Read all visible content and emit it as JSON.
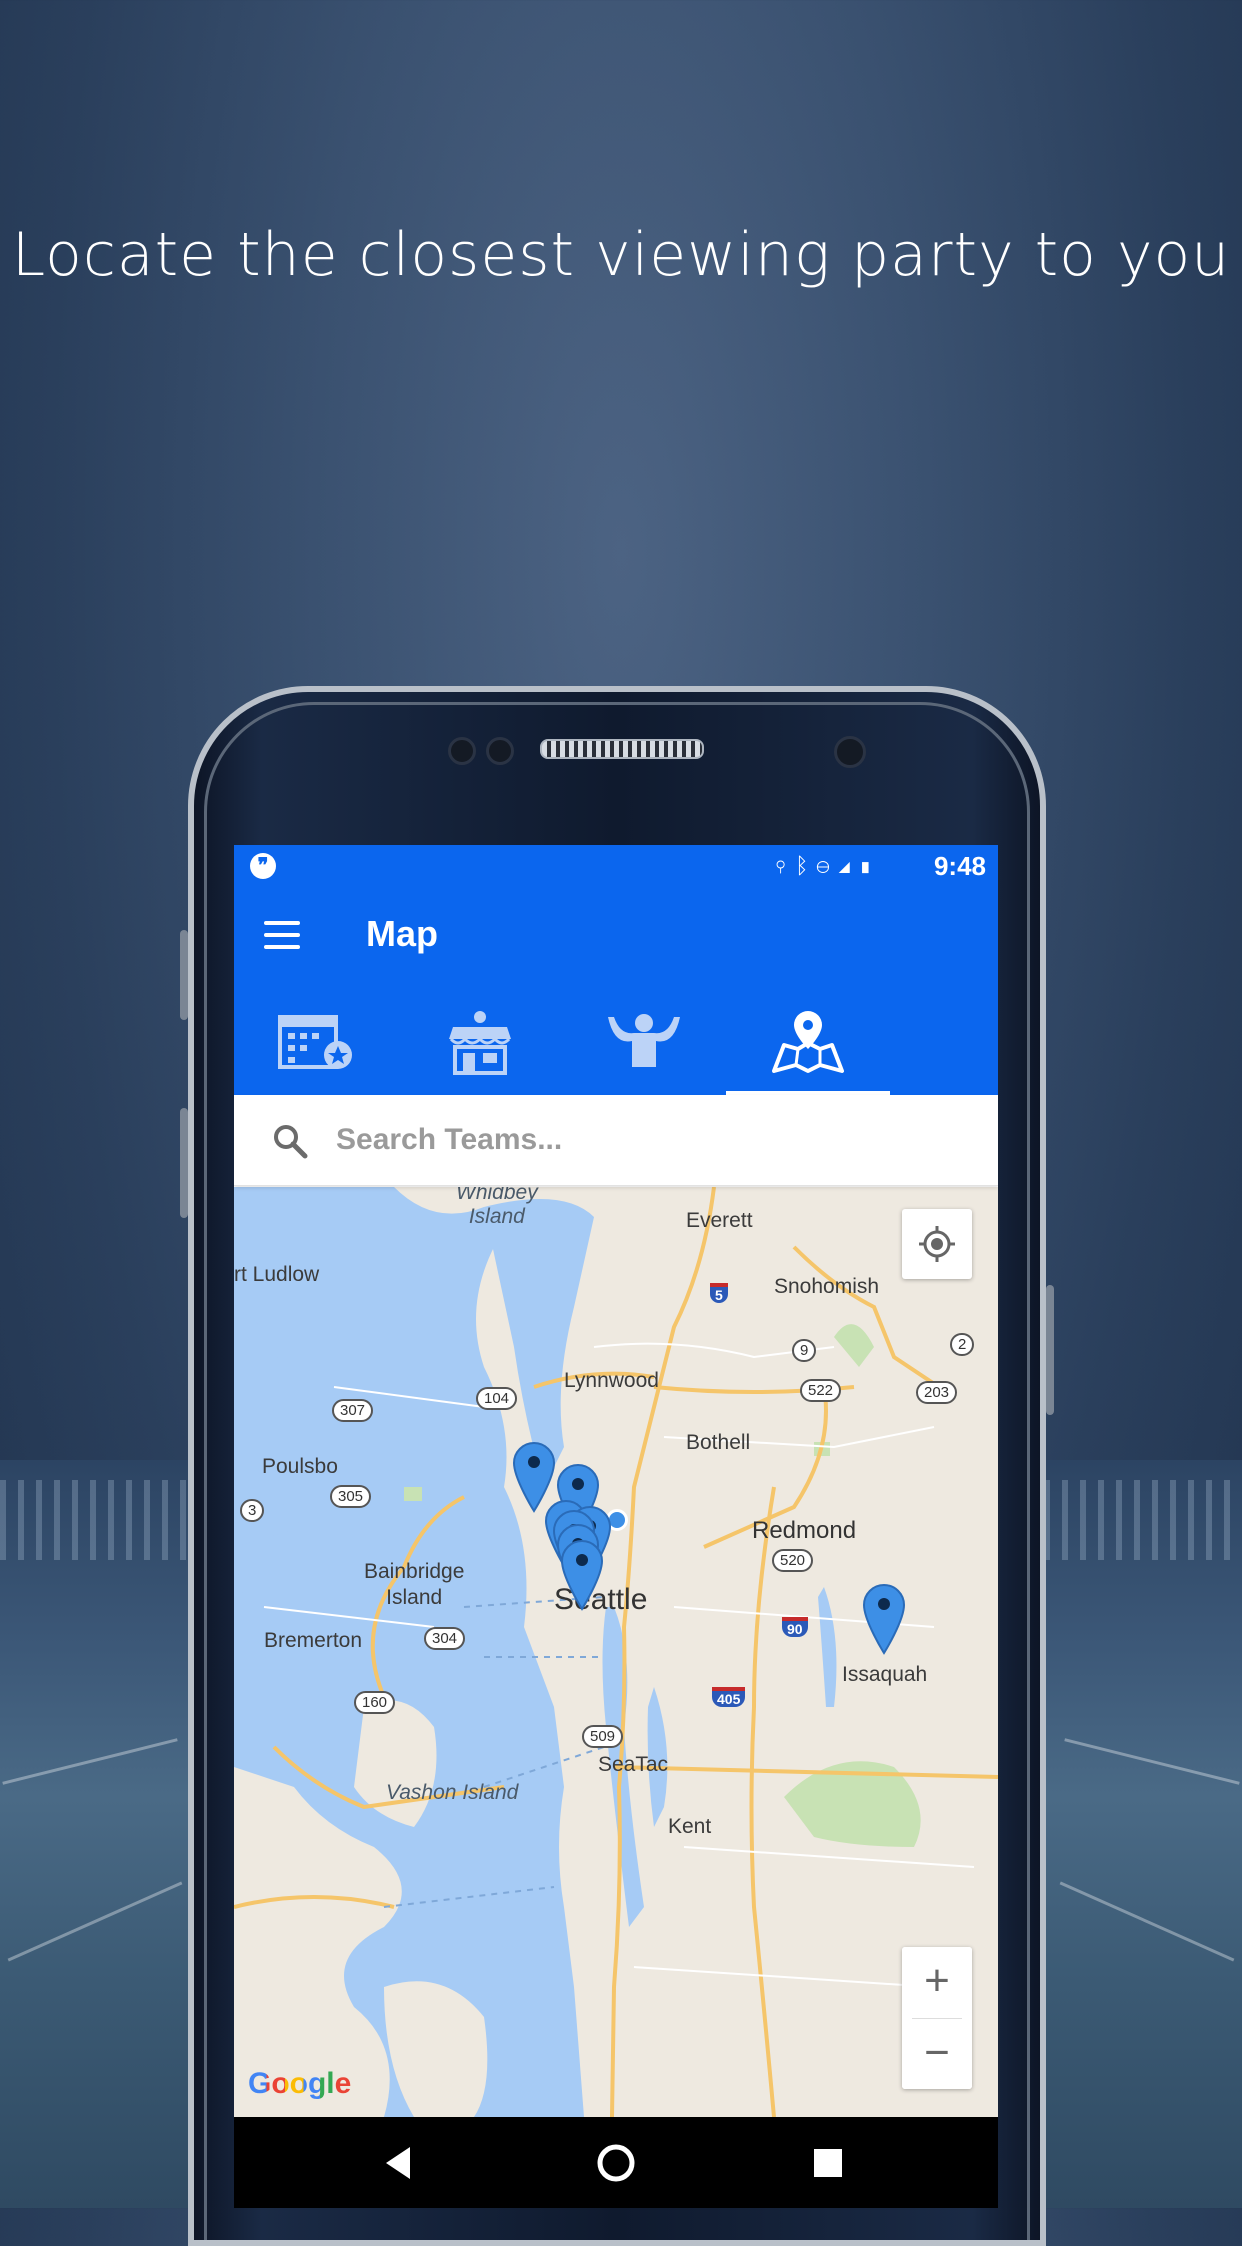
{
  "headline": "Locate the closest viewing party to you",
  "status_bar": {
    "time": "9:48",
    "left_icon": "hangouts-icon",
    "right_icons": [
      "location-icon",
      "bluetooth-icon",
      "do-not-disturb-icon",
      "lte-signal-icon",
      "battery-charging-icon"
    ]
  },
  "app_bar": {
    "title": "Map",
    "menu_icon": "hamburger-menu-icon"
  },
  "tabs": [
    {
      "name": "calendar",
      "icon": "calendar-star-icon",
      "active": false
    },
    {
      "name": "venues",
      "icon": "storefront-icon",
      "active": false
    },
    {
      "name": "fans",
      "icon": "cheering-fan-icon",
      "active": false
    },
    {
      "name": "map",
      "icon": "map-pin-icon",
      "active": true
    }
  ],
  "search": {
    "placeholder": "Search Teams..."
  },
  "map": {
    "labels": {
      "whidbey": "Whidbey\nIsland",
      "everett": "Everett",
      "port_ludlow": "rt Ludlow",
      "snohomish": "Snohomish",
      "lynnwood": "Lynnwood",
      "poulsbo": "Poulsbo",
      "bothell": "Bothell",
      "redmond": "Redmond",
      "bainbridge": "Bainbridge\nIsland",
      "seattle": "Seattle",
      "bremerton": "Bremerton",
      "issaquah": "Issaquah",
      "seatac": "SeaTac",
      "vashon": "Vashon Island",
      "kent": "Kent"
    },
    "shields": {
      "r307": "307",
      "r104": "104",
      "r305": "305",
      "r3": "3",
      "r9": "9",
      "r522": "522",
      "r203": "203",
      "r2": "2",
      "r520": "520",
      "r304": "304",
      "r160": "160",
      "r509": "509"
    },
    "interstates": {
      "i5": "5",
      "i90": "90",
      "i405": "405"
    },
    "pin_count": 8,
    "attribution": "Google",
    "zoom_in": "+",
    "zoom_out": "−"
  },
  "colors": {
    "primary": "#0b66ee",
    "water": "#a6cbf5",
    "land": "#eee9e0",
    "pin": "#3d8fe6"
  },
  "nav_bar": [
    "back-icon",
    "home-icon",
    "recents-icon"
  ]
}
